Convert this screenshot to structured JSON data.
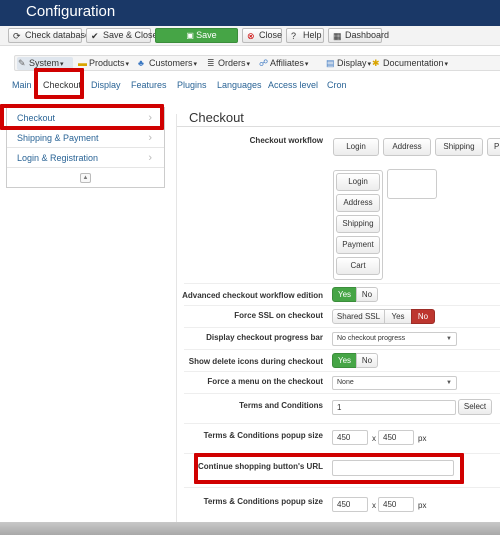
{
  "title": "Configuration",
  "toolbar": {
    "check_database": "Check database",
    "save_close": "Save & Close",
    "save": "Save",
    "close": "Close",
    "help": "Help",
    "dashboard": "Dashboard"
  },
  "menubar": {
    "system": "System",
    "products": "Products",
    "customers": "Customers",
    "orders": "Orders",
    "affiliates": "Affiliates",
    "display": "Display",
    "documentation": "Documentation"
  },
  "tabs": [
    "Main",
    "Checkout",
    "Display",
    "Features",
    "Plugins",
    "Languages",
    "Access level",
    "Cron"
  ],
  "sidebar": {
    "items": [
      "Checkout",
      "Shipping & Payment",
      "Login & Registration"
    ]
  },
  "panel": {
    "title": "Checkout",
    "workflow_label": "Checkout workflow",
    "workflow_row": [
      "Login",
      "Address",
      "Shipping",
      "P"
    ],
    "workflow_stack": [
      "Login",
      "Address",
      "Shipping",
      "Payment",
      "Cart"
    ],
    "advanced_label": "Advanced checkout workflow edition",
    "advanced_yes": "Yes",
    "advanced_no": "No",
    "force_ssl_label": "Force SSL on checkout",
    "force_ssl_shared": "Shared SSL",
    "force_ssl_yes": "Yes",
    "force_ssl_no": "No",
    "progress_label": "Display checkout progress bar",
    "progress_value": "No checkout progress",
    "delete_label": "Show delete icons during checkout",
    "delete_yes": "Yes",
    "delete_no": "No",
    "menu_label": "Force a menu on the checkout",
    "menu_value": "None",
    "terms_label": "Terms and Conditions",
    "terms_value": "1",
    "terms_select": "Select",
    "popup_label": "Terms & Conditions popup size",
    "popup_w": "450",
    "popup_h": "450",
    "popup_x": "x",
    "popup_unit": "px",
    "continue_label": "Continue shopping button's URL",
    "continue_value": "",
    "popup2_label": "Terms & Conditions popup size",
    "popup2_w": "450",
    "popup2_h": "450",
    "popup2_x": "x",
    "popup2_unit": "px"
  },
  "colors": {
    "titlebar": "#1a3867",
    "save_green": "#46a546",
    "no_red": "#bd362f",
    "highlight": "#d00000",
    "link": "#2a6496"
  }
}
